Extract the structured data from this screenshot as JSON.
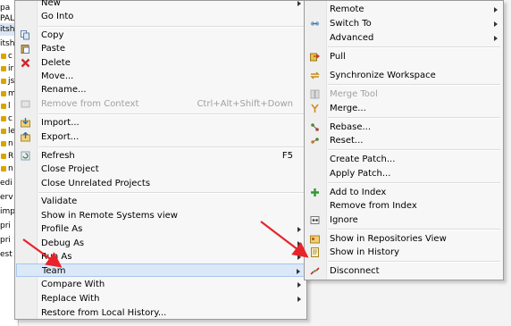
{
  "explorer": {
    "rows": [
      "pa",
      "PAL",
      "itsh",
      "itsh",
      "c",
      "ir",
      "js",
      "m",
      "l",
      "c",
      "le",
      "n",
      "R",
      "n",
      "edi",
      "erv",
      "imp",
      "pri",
      "pri",
      "est"
    ]
  },
  "main_menu": {
    "new": "New",
    "go_into": "Go Into",
    "copy": "Copy",
    "paste": "Paste",
    "delete": "Delete",
    "move": "Move...",
    "rename": "Rename...",
    "remove_from_context": "Remove from Context",
    "remove_from_context_shortcut": "Ctrl+Alt+Shift+Down",
    "import": "Import...",
    "export": "Export...",
    "refresh": "Refresh",
    "refresh_shortcut": "F5",
    "close_project": "Close Project",
    "close_unrelated": "Close Unrelated Projects",
    "validate": "Validate",
    "show_remote": "Show in Remote Systems view",
    "profile_as": "Profile As",
    "debug_as": "Debug As",
    "run_as": "Run As",
    "team": "Team",
    "compare_with": "Compare With",
    "replace_with": "Replace With",
    "restore_history": "Restore from Local History..."
  },
  "team_menu": {
    "remote": "Remote",
    "switch_to": "Switch To",
    "advanced": "Advanced",
    "pull": "Pull",
    "synchronize": "Synchronize Workspace",
    "merge_tool": "Merge Tool",
    "merge": "Merge...",
    "rebase": "Rebase...",
    "reset": "Reset...",
    "create_patch": "Create Patch...",
    "apply_patch": "Apply Patch...",
    "add_to_index": "Add to Index",
    "remove_from_index": "Remove from Index",
    "ignore": "Ignore",
    "show_repositories": "Show in Repositories View",
    "show_history": "Show in History",
    "disconnect": "Disconnect"
  },
  "colors": {
    "highlight": "#dbe8f8",
    "annotation_arrow": "#e8242a"
  },
  "icons": [
    "copy-icon",
    "paste-icon",
    "delete-icon",
    "remove-context-icon",
    "import-icon",
    "export-icon",
    "refresh-icon",
    "fetch-icon",
    "pull-icon",
    "synchronize-icon",
    "merge-tool-icon",
    "merge-icon",
    "rebase-icon",
    "reset-icon",
    "add-index-icon",
    "ignore-icon",
    "repositories-icon",
    "history-icon",
    "disconnect-icon"
  ]
}
